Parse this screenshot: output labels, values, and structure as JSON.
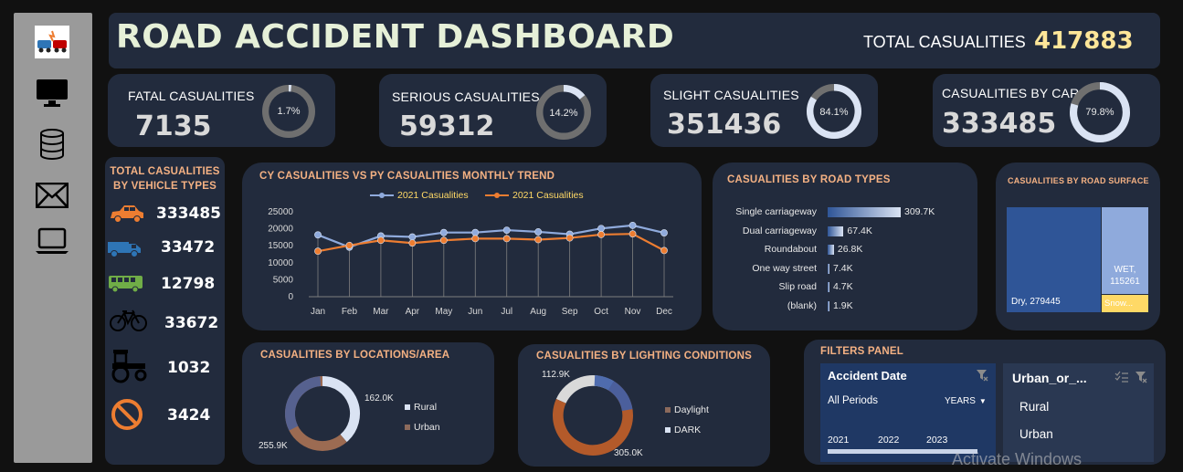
{
  "header": {
    "title": "ROAD ACCIDENT DASHBOARD",
    "total_label": "TOTAL CASUALITIES",
    "total_value": "417883"
  },
  "sidebar": {
    "items": [
      {
        "name": "accident-logo-icon"
      },
      {
        "name": "monitor-icon"
      },
      {
        "name": "database-icon"
      },
      {
        "name": "mail-icon"
      },
      {
        "name": "laptop-icon"
      }
    ]
  },
  "kpis": [
    {
      "label": "FATAL CASUALITIES",
      "value": "7135",
      "pct_label": "1.7%",
      "pct": 0.017
    },
    {
      "label": "SERIOUS CASUALITIES",
      "value": "59312",
      "pct_label": "14.2%",
      "pct": 0.142
    },
    {
      "label": "SLIGHT CASUALITIES",
      "value": "351436",
      "pct_label": "84.1%",
      "pct": 0.841
    },
    {
      "label": "CASUALITIES BY CAR",
      "value": "333485",
      "pct_label": "79.8%",
      "pct": 0.798
    }
  ],
  "vehicle_types": {
    "title_line1": "TOTAL CASUALITIES",
    "title_line2": "BY VEHICLE TYPES",
    "items": [
      {
        "icon": "car-icon",
        "value": "333485",
        "color": "#f4b183"
      },
      {
        "icon": "van-icon",
        "value": "33472",
        "color": "#8faadc"
      },
      {
        "icon": "bus-icon",
        "value": "12798",
        "color": "#c5e0b4"
      },
      {
        "icon": "bicycle-icon",
        "value": "33672",
        "color": "#0a0a0a"
      },
      {
        "icon": "tractor-icon",
        "value": "1032",
        "color": "#0a0a0a"
      },
      {
        "icon": "prohibited-icon",
        "value": "3424",
        "color": "#ed7d31"
      }
    ]
  },
  "colors": {
    "card": "#222b3d",
    "accent_orange": "#ed7d31",
    "accent_blue": "#8faadc",
    "title_orange": "#f4b183",
    "total_yellow": "#ffe699",
    "donut_track": "#6f6f6f",
    "donut_fill": "#dae3f3"
  },
  "trend": {
    "title": "CY CASUALITIES VS PY CASUALITIES MONTHLY TREND",
    "chart_data": {
      "type": "line",
      "categories": [
        "Jan",
        "Feb",
        "Mar",
        "Apr",
        "May",
        "Jun",
        "Jul",
        "Aug",
        "Sep",
        "Oct",
        "Nov",
        "Dec"
      ],
      "series": [
        {
          "name": "2021 Casualities",
          "color": "#8faadc",
          "values": [
            18200,
            14600,
            17900,
            17600,
            18900,
            18900,
            19600,
            19100,
            18400,
            20100,
            21000,
            18800
          ]
        },
        {
          "name": "2021 Casualities",
          "color": "#ed7d31",
          "values": [
            13400,
            15100,
            16600,
            15800,
            16600,
            17100,
            17100,
            16800,
            17300,
            18300,
            18500,
            13600
          ]
        }
      ],
      "yticks": [
        "25000",
        "20000",
        "15000",
        "10000",
        "5000",
        "0"
      ],
      "ylim": [
        0,
        25000
      ],
      "grid": false,
      "legend": "top"
    }
  },
  "road_types": {
    "title": "CASUALITIES BY ROAD TYPES",
    "chart_data": {
      "type": "bar",
      "categories": [
        "Single carriageway",
        "Dual carriageway",
        "Roundabout",
        "One way street",
        "Slip road",
        "(blank)"
      ],
      "values": [
        309700,
        67400,
        26800,
        7400,
        4700,
        1900
      ],
      "value_labels": [
        "309.7K",
        "67.4K",
        "26.8K",
        "7.4K",
        "4.7K",
        "1.9K"
      ]
    }
  },
  "road_surface": {
    "title": "CASUALITIES BY ROAD SURFACE",
    "chart_data": {
      "type": "treemap",
      "categories": [
        "Dry",
        "WET",
        "Snow..."
      ],
      "values": [
        279445,
        115261,
        23177
      ],
      "labels": [
        "Dry, 279445",
        "WET,",
        "115261",
        "Snow..."
      ]
    }
  },
  "location": {
    "title": "CASUALITIES BY LOCATIONS/AREA",
    "chart_data": {
      "type": "pie",
      "categories": [
        "Rural",
        "Urban"
      ],
      "values": [
        162000,
        255900
      ],
      "value_labels": [
        "162.0K",
        "255.9K"
      ]
    }
  },
  "lighting": {
    "title": "CASUALITIES BY LIGHTING CONDITIONS",
    "chart_data": {
      "type": "pie",
      "categories": [
        "Daylight",
        "DARK"
      ],
      "values": [
        305000,
        112900
      ],
      "value_labels": [
        "305.0K",
        "112.9K"
      ]
    }
  },
  "filters": {
    "title": "FILTERS PANEL",
    "accident_date": {
      "title": "Accident Date",
      "period": "All Periods",
      "granularity": "YEARS",
      "years": [
        "2021",
        "2022",
        "2023"
      ]
    },
    "urban_rural": {
      "title": "Urban_or_...",
      "options": [
        "Rural",
        "Urban"
      ]
    }
  },
  "watermark": "Activate Windows"
}
